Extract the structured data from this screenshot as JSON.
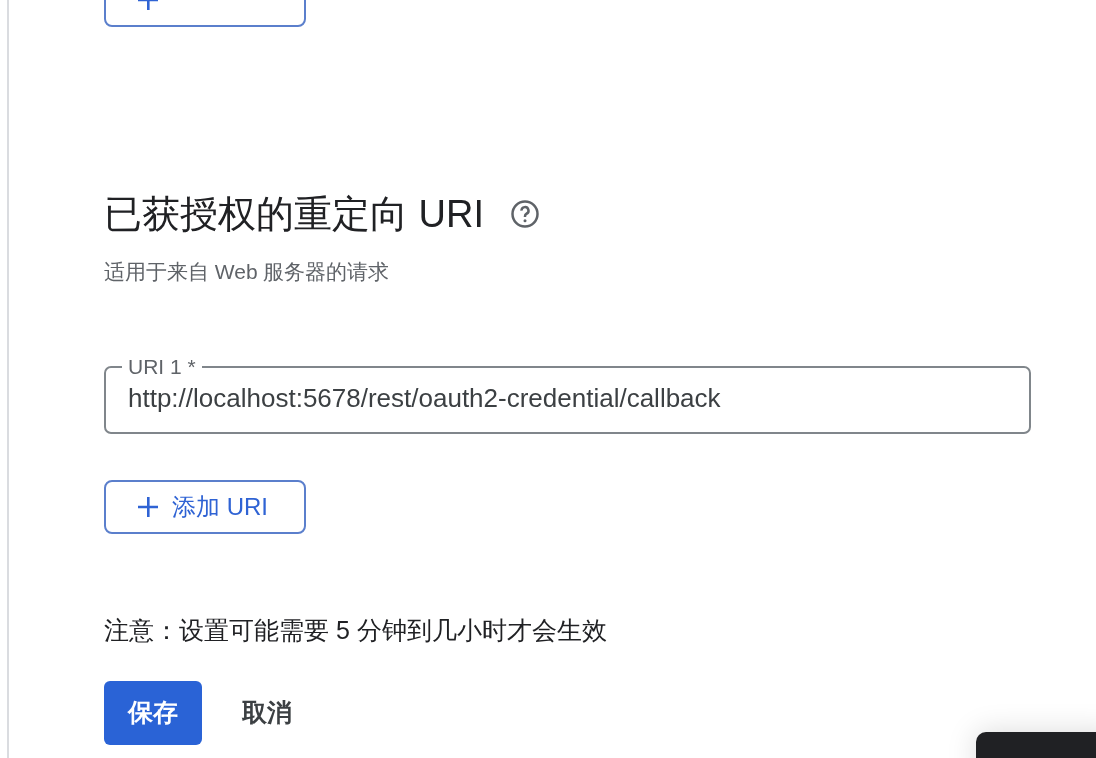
{
  "section": {
    "title": "已获授权的重定向 URI",
    "subtitle": "适用于来自 Web 服务器的请求"
  },
  "uri_fields": [
    {
      "label": "URI 1 *",
      "value": "http://localhost:5678/rest/oauth2-credential/callback"
    }
  ],
  "add_button": {
    "label": "添加 URI"
  },
  "note": "注意：设置可能需要 5 分钟到几小时才会生效",
  "actions": [
    {
      "label": "保存",
      "kind": "primary"
    },
    {
      "label": "取消",
      "kind": "text"
    }
  ]
}
